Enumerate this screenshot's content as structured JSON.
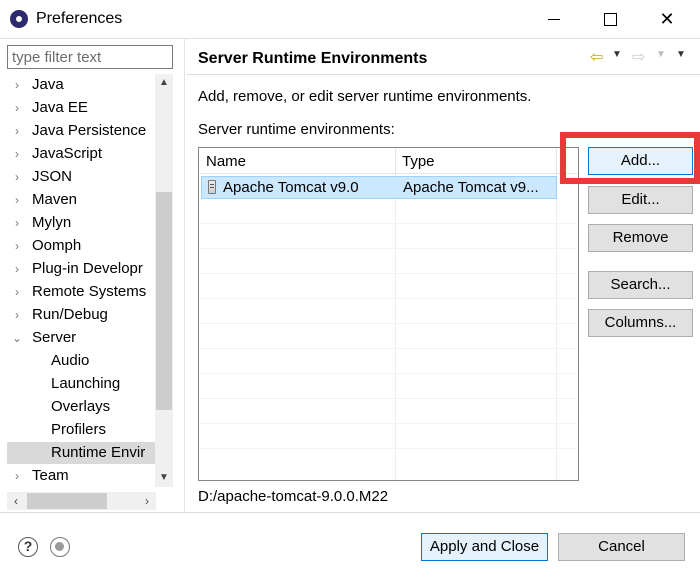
{
  "window": {
    "title": "Preferences",
    "minimize": "",
    "maximize": "",
    "close": "✕"
  },
  "sidebar": {
    "filter_placeholder": "type filter text",
    "items": [
      {
        "label": "Java",
        "arrow": "›"
      },
      {
        "label": "Java EE",
        "arrow": "›"
      },
      {
        "label": "Java Persistence",
        "arrow": "›"
      },
      {
        "label": "JavaScript",
        "arrow": "›"
      },
      {
        "label": "JSON",
        "arrow": "›"
      },
      {
        "label": "Maven",
        "arrow": "›"
      },
      {
        "label": "Mylyn",
        "arrow": "›"
      },
      {
        "label": "Oomph",
        "arrow": "›"
      },
      {
        "label": "Plug-in Developr",
        "arrow": "›"
      },
      {
        "label": "Remote Systems",
        "arrow": "›"
      },
      {
        "label": "Run/Debug",
        "arrow": "›"
      },
      {
        "label": "Server",
        "arrow": "⌄"
      },
      {
        "label": "Audio"
      },
      {
        "label": "Launching"
      },
      {
        "label": "Overlays"
      },
      {
        "label": "Profilers"
      },
      {
        "label": "Runtime Envir"
      },
      {
        "label": "Team",
        "arrow": "›"
      }
    ],
    "scroll_up": "▲",
    "scroll_down": "▼",
    "scroll_left": "‹",
    "scroll_right": "›"
  },
  "page": {
    "title": "Server Runtime Environments",
    "description": "Add, remove, or edit server runtime environments.",
    "list_label": "Server runtime environments:",
    "nav": {
      "back": "⇦",
      "back_dropdown": "▼",
      "forward": "⇨",
      "forward_dropdown": "▼",
      "menu": "▼"
    },
    "table": {
      "columns": [
        "Name",
        "Type"
      ],
      "rows": [
        {
          "name": "Apache Tomcat v9.0",
          "type": "Apache Tomcat v9..."
        }
      ]
    },
    "buttons": {
      "add": "Add...",
      "edit": "Edit...",
      "remove": "Remove",
      "search": "Search...",
      "columns": "Columns..."
    },
    "path": "D:/apache-tomcat-9.0.0.M22"
  },
  "footer": {
    "help": "?",
    "apply_close": "Apply and Close",
    "cancel": "Cancel"
  },
  "colors": {
    "highlight": "#e8393b",
    "selection": "#cce8ff",
    "primary_border": "#0078d7"
  }
}
